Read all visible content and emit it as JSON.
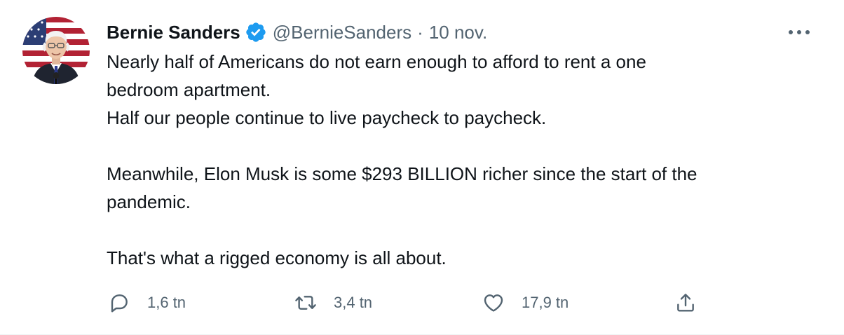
{
  "author": {
    "name": "Bernie Sanders",
    "handle": "@BernieSanders",
    "separator": "·",
    "date": "10 nov.",
    "verified_color": "#1d9bf0"
  },
  "tweet": {
    "lines": [
      "Nearly half of Americans do not earn enough to afford to rent a one",
      "bedroom apartment.",
      "Half our people continue to live paycheck to paycheck.",
      "",
      "Meanwhile, Elon Musk is some $293 BILLION richer since the start of the",
      "pandemic.",
      "",
      "That's what a rigged economy is all about."
    ]
  },
  "actions": {
    "reply": {
      "icon": "reply-icon",
      "count": "1,6 tn"
    },
    "retweet": {
      "icon": "retweet-icon",
      "count": "3,4 tn"
    },
    "like": {
      "icon": "heart-icon",
      "count": "17,9 tn"
    },
    "share": {
      "icon": "share-icon"
    }
  },
  "colors": {
    "text": "#0f1419",
    "secondary": "#536471",
    "verified": "#1d9bf0"
  }
}
